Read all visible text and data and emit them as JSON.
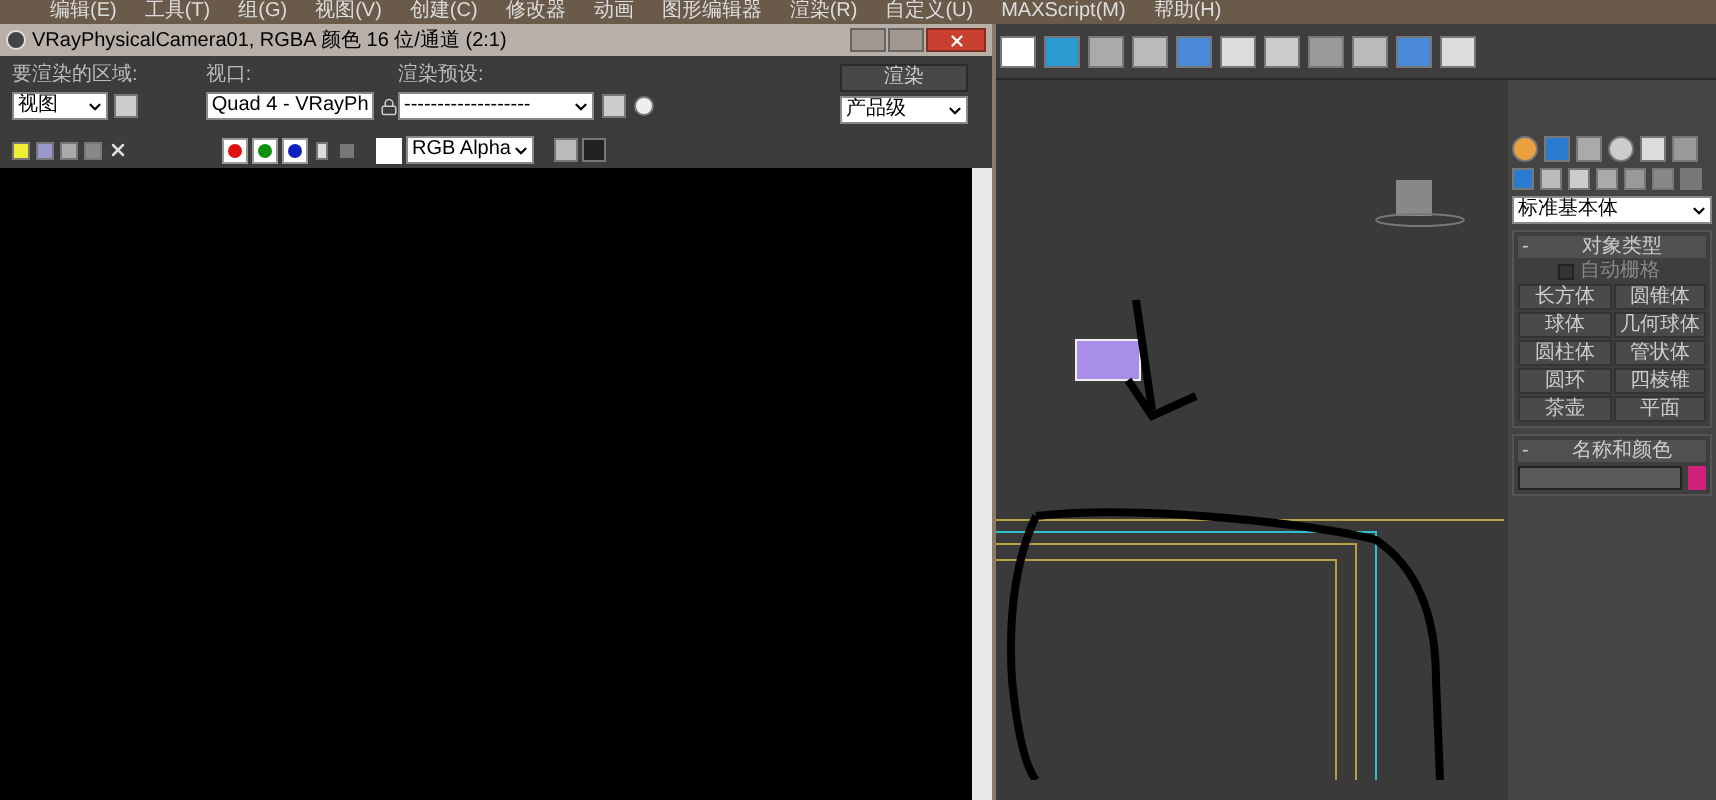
{
  "menu_bar": [
    "编辑(E)",
    "工具(T)",
    "组(G)",
    "视图(V)",
    "创建(C)",
    "修改器",
    "动画",
    "图形编辑器",
    "渲染(R)",
    "自定义(U)",
    "MAXScript(M)",
    "帮助(H)"
  ],
  "render_window": {
    "title": "VRayPhysicalCamera01, RGBA 颜色 16 位/通道 (2:1)",
    "area": {
      "label": "要渲染的区域:",
      "value": "视图"
    },
    "viewport": {
      "label": "视口:",
      "value": "Quad 4 - VRayPh"
    },
    "preset": {
      "label": "渲染预设:",
      "value": "-------------------"
    },
    "render_button": "渲染",
    "quality": {
      "value": "产品级"
    },
    "channels": [
      {
        "color": "#e01010",
        "selected": true
      },
      {
        "color": "#109010",
        "selected": true
      },
      {
        "color": "#1020c0",
        "selected": true
      }
    ],
    "display": {
      "value": "RGB Alpha"
    }
  },
  "command_panel": {
    "category": "标准基本体",
    "object_type": {
      "collapse": "-",
      "title": "对象类型",
      "autogrid": {
        "label": "自动栅格",
        "checked": false
      },
      "buttons": [
        "长方体",
        "圆锥体",
        "球体",
        "几何球体",
        "圆柱体",
        "管状体",
        "圆环",
        "四棱锥",
        "茶壶",
        "平面"
      ]
    },
    "name_color": {
      "collapse": "-",
      "title": "名称和颜色",
      "color": "#d0207a"
    }
  }
}
